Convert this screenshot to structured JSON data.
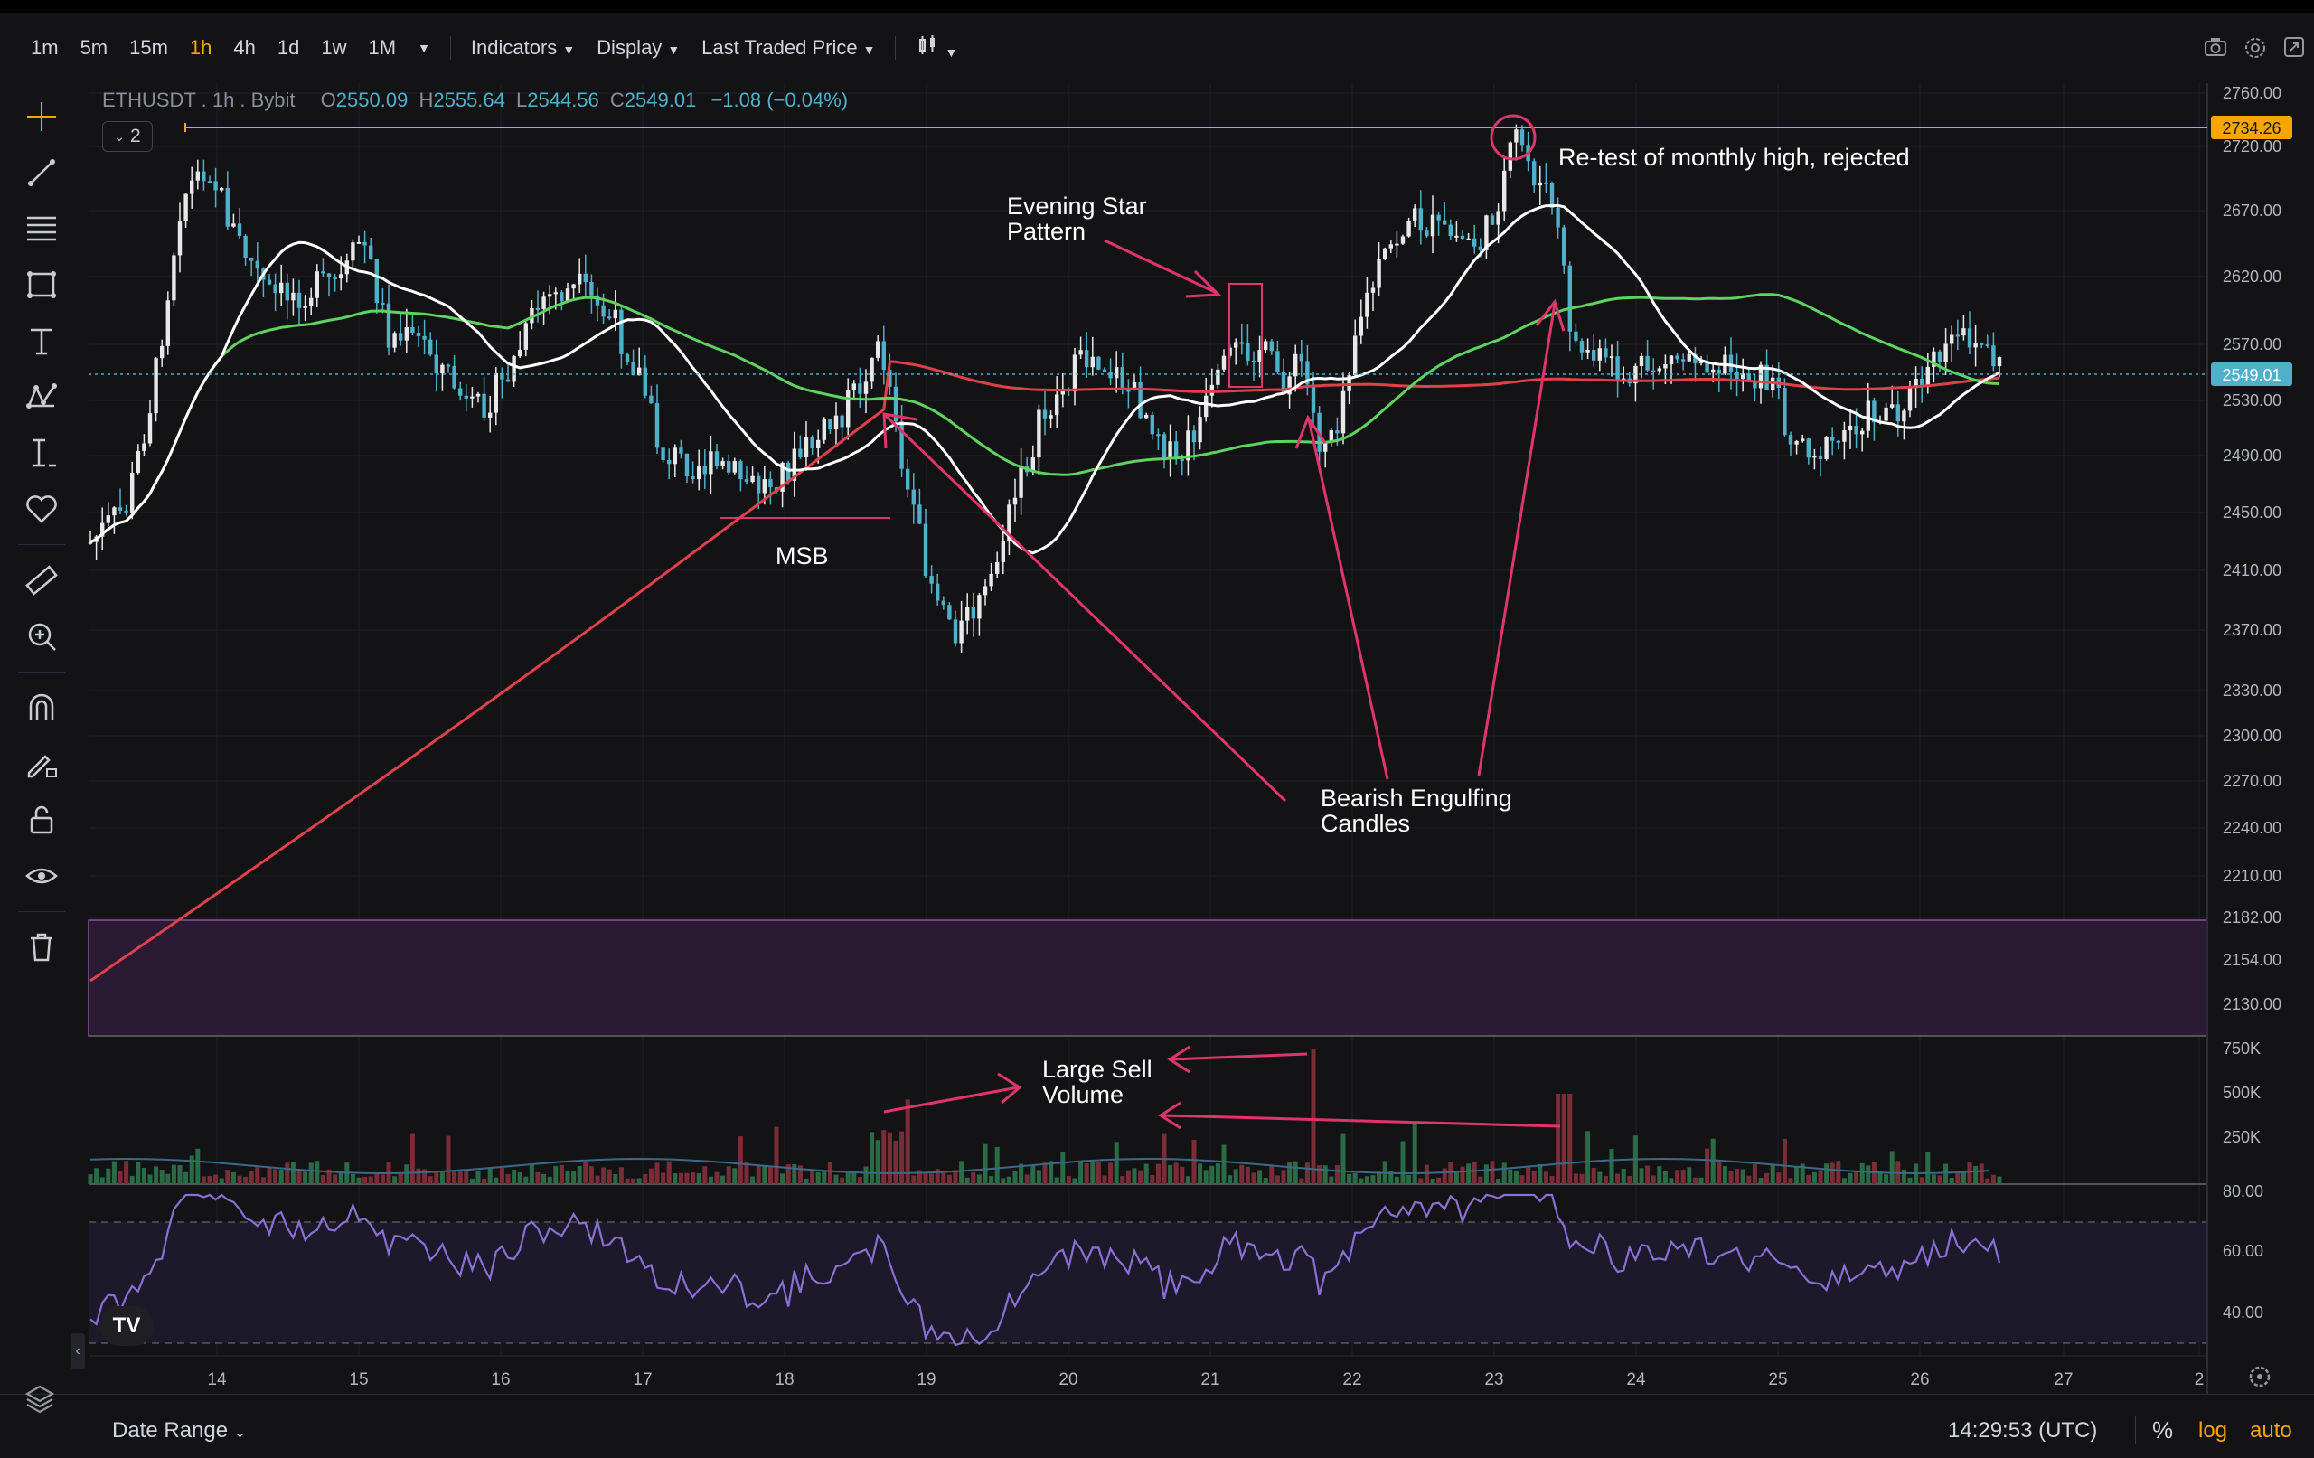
{
  "toolbar": {
    "timeframes": [
      "1m",
      "5m",
      "15m",
      "1h",
      "4h",
      "1d",
      "1w",
      "1M"
    ],
    "active_timeframe": "1h",
    "indicators_label": "Indicators",
    "display_label": "Display",
    "price_type_label": "Last Traded Price"
  },
  "legend": {
    "symbol": "ETHUSDT . 1h . Bybit",
    "open_key": "O",
    "open": "2550.09",
    "high_key": "H",
    "high": "2555.64",
    "low_key": "L",
    "low": "2544.56",
    "close_key": "C",
    "close": "2549.01",
    "change": "−1.08 (−0.04%)",
    "collapse_count": "2"
  },
  "price_axis": {
    "labels": [
      "2760.00",
      "2720.00",
      "2670.00",
      "2620.00",
      "2570.00",
      "2530.00",
      "2490.00",
      "2450.00",
      "2410.00",
      "2370.00",
      "2330.00",
      "2300.00",
      "2270.00",
      "2240.00",
      "2210.00",
      "2182.00",
      "2154.00",
      "2130.00"
    ],
    "highlight_high": "2734.26",
    "highlight_last": "2549.01"
  },
  "volume_axis": {
    "labels": [
      "750K",
      "500K",
      "250K"
    ]
  },
  "rsi_axis": {
    "labels": [
      "80.00",
      "60.00",
      "40.00"
    ]
  },
  "time_axis": {
    "labels": [
      "14",
      "15",
      "16",
      "17",
      "18",
      "19",
      "20",
      "21",
      "22",
      "23",
      "24",
      "25",
      "26",
      "27",
      "2"
    ]
  },
  "annotations": {
    "retest": "Re-test of monthly high, rejected",
    "evening_star_line1": "Evening Star",
    "evening_star_line2": "Pattern",
    "msb": "MSB",
    "bearish_line1": "Bearish Engulfing",
    "bearish_line2": "Candles",
    "volume_line1": "Large Sell",
    "volume_line2": "Volume"
  },
  "bottom": {
    "date_range": "Date Range",
    "clock": "14:29:53 (UTC)",
    "percent": "%",
    "log": "log",
    "auto": "auto"
  },
  "colors": {
    "up": "#e8e8e8",
    "down": "#4fb0c9",
    "accent": "#f7a600",
    "ma_white": "#ffffff",
    "ma_green": "#5fd35f",
    "ma_red": "#e0404a",
    "annotation": "#e0356a",
    "rsi": "#8b6fd6",
    "zone": "#2a1a33"
  },
  "icons": [
    "crosshair-icon",
    "trend-line-icon",
    "fib-icon",
    "rectangle-icon",
    "text-icon",
    "pattern-icon",
    "measure-icon",
    "heart-icon",
    "ruler-icon",
    "zoom-icon",
    "magnet-icon",
    "pencil-lock-icon",
    "lock-icon",
    "eye-icon",
    "trash-icon",
    "camera-icon",
    "settings-icon",
    "fullscreen-icon",
    "layers-icon"
  ]
}
